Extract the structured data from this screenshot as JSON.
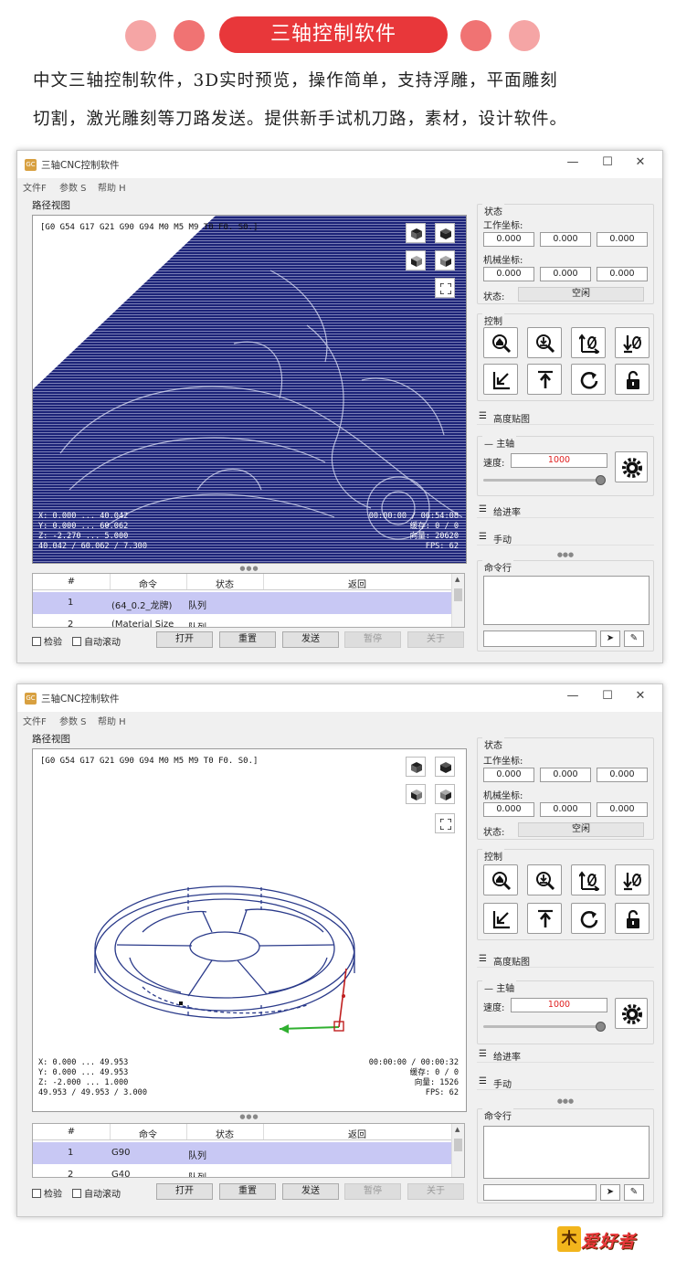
{
  "banner": {
    "title": "三轴控制软件",
    "line1": "中文三轴控制软件，3D实时预览，操作简单，支持浮雕，平面雕刻",
    "line2": "切割，激光雕刻等刀路发送。提供新手试机刀路，素材，设计软件。"
  },
  "window": {
    "title": "三轴CNC控制软件",
    "menu": [
      "文件F",
      "参数 S",
      "帮助 H"
    ],
    "controls": {
      "minimize": "—",
      "maximize": "☐",
      "close": "✕"
    }
  },
  "path_view": {
    "label": "路径视图"
  },
  "table_headers": [
    "#",
    "命令",
    "状态",
    "返回"
  ],
  "bottom": {
    "check_label": "检验",
    "autoscroll_label": "自动滚动",
    "open": "打开",
    "reset": "重置",
    "send": "发送",
    "pause": "暂停",
    "about": "关于"
  },
  "panel": {
    "status_group": "状态",
    "work_coord": "工作坐标:",
    "machine_coord": "机械坐标:",
    "state_label": "状态:",
    "control_group": "控制",
    "height_map": "高度贴图",
    "spindle": "主轴",
    "speed_label": "速度:",
    "feed_rate": "给进率",
    "manual": "手动",
    "command_line": "命令行"
  },
  "screen1": {
    "gcode": "[G0 G54 G17 G21 G90 G94 M0 M5 M9 T0 F0. S0.]",
    "readout_left": [
      "X: 0.000 ... 40.042",
      "Y: 0.000 ... 60.062",
      "Z: -2.270 ... 5.000",
      "40.042 / 60.062 / 7.300"
    ],
    "readout_right": [
      "00:00:00 / 06:54:08",
      "缓存:  0 / 0",
      "向量: 20620",
      "FPS: 62"
    ],
    "work": [
      "0.000",
      "0.000",
      "0.000"
    ],
    "machine": [
      "0.000",
      "0.000",
      "0.000"
    ],
    "state": "空闲",
    "speed": "1000",
    "speed_fraction": 1.0,
    "rows": [
      {
        "num": "1",
        "cmd": "(64_0.2_龙牌)",
        "status": "队列",
        "resp": ""
      },
      {
        "num": "2",
        "cmd": "(Material Size",
        "status": "队列",
        "resp": ""
      }
    ]
  },
  "screen2": {
    "gcode": "[G0 G54 G17 G21 G90 G94 M0 M5 M9 T0 F0. S0.]",
    "readout_left": [
      "X: 0.000 ... 49.953",
      "Y: 0.000 ... 49.953",
      "Z: -2.000 ... 1.000",
      "49.953 / 49.953 / 3.000"
    ],
    "readout_right": [
      "00:00:00 / 00:00:32",
      "缓存:  0 / 0",
      "向量: 1526",
      "FPS: 62"
    ],
    "work": [
      "0.000",
      "0.000",
      "0.000"
    ],
    "machine": [
      "0.000",
      "0.000",
      "0.000"
    ],
    "state": "空闲",
    "speed": "1000",
    "speed_fraction": 1.0,
    "rows": [
      {
        "num": "1",
        "cmd": "G90",
        "status": "队列",
        "resp": ""
      },
      {
        "num": "2",
        "cmd": "G40",
        "status": "队列",
        "resp": ""
      }
    ]
  },
  "brand": {
    "logo": "木",
    "name": "爱好者"
  },
  "colors": {
    "accent": "#e8373a",
    "relief": "#1c2378",
    "selected_row": "#c8c8f4",
    "speed": "#e02020"
  }
}
